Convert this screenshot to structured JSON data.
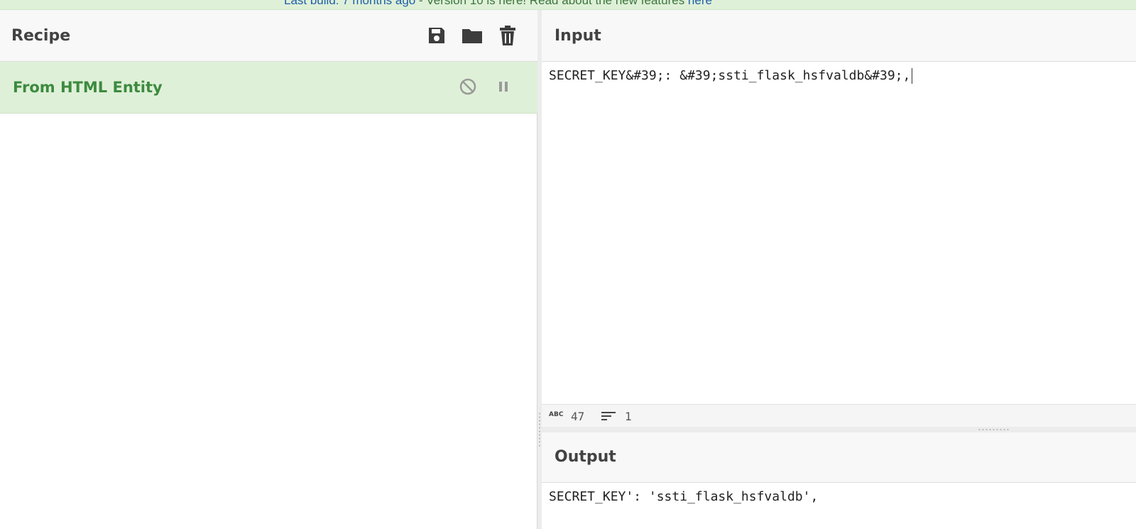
{
  "banner": {
    "left_text": "Last build: 7 months ago",
    "middle_text": " - Version 10 is here! Read about the new features ",
    "link_text": "here"
  },
  "recipe": {
    "title": "Recipe",
    "icons": [
      "save-icon",
      "folder-icon",
      "trash-icon"
    ],
    "operations": [
      {
        "name": "From HTML Entity",
        "controls": [
          "disable-icon",
          "pause-icon"
        ]
      }
    ]
  },
  "input": {
    "title": "Input",
    "text": "SECRET_KEY&#39;: &#39;ssti_flask_hsfvaldb&#39;,",
    "status": {
      "length_icon_label": "ABC",
      "length": "47",
      "lines": "1"
    }
  },
  "output": {
    "title": "Output",
    "text": "SECRET_KEY': 'ssti_flask_hsfvaldb',"
  },
  "colors": {
    "banner_bg": "#dff0d8",
    "operation_bg": "#dff0d8",
    "operation_text": "#3c8a3f",
    "link": "#1f5fa8"
  }
}
